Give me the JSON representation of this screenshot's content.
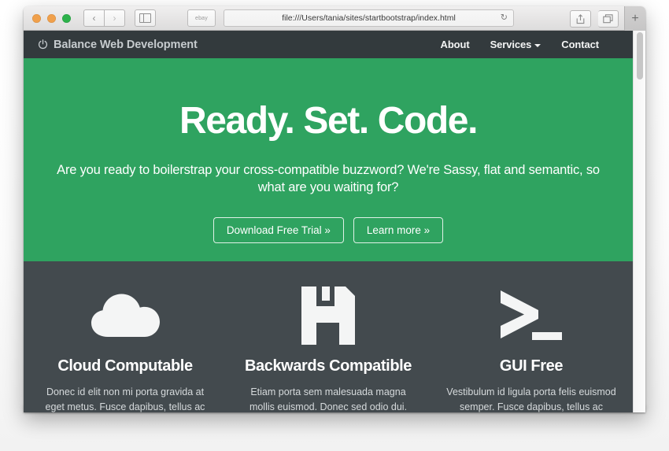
{
  "browser": {
    "traffic_lights": [
      "close",
      "minimize",
      "zoom"
    ],
    "back_label": "‹",
    "forward_label": "›",
    "sidebar_icon": "sidebar-icon",
    "bookmark_label": "ebay",
    "url": "file:///Users/tania/sites/startbootstrap/index.html",
    "reload_label": "↻",
    "share_icon": "share-icon",
    "tabs_icon": "tabs-icon",
    "new_tab_label": "+"
  },
  "site": {
    "nav": {
      "brand": "Balance Web Development",
      "brand_icon": "power-icon",
      "links": [
        {
          "label": "About",
          "has_caret": false
        },
        {
          "label": "Services",
          "has_caret": true
        },
        {
          "label": "Contact",
          "has_caret": false
        }
      ]
    },
    "hero": {
      "heading": "Ready. Set. Code.",
      "lead": "Are you ready to boilerstrap your cross-compatible buzzword? We're Sassy, flat and semantic, so what are you waiting for?",
      "primary_button": "Download Free Trial »",
      "secondary_button": "Learn more »"
    },
    "features": [
      {
        "icon": "cloud-icon",
        "title": "Cloud Computable",
        "body": "Donec id elit non mi porta gravida at eget metus. Fusce dapibus, tellus ac cursus commodo, tortor mauris condimentum"
      },
      {
        "icon": "floppy-disk-icon",
        "title": "Backwards Compatible",
        "body": "Etiam porta sem malesuada magna mollis euismod. Donec sed odio dui. Lorem ipsum dolor."
      },
      {
        "icon": "terminal-icon",
        "title": "GUI Free",
        "body": "Vestibulum id ligula porta felis euismod semper. Fusce dapibus, tellus ac cursus commodo, tortor mauris condimentum"
      }
    ],
    "colors": {
      "accent_green": "#2fa360",
      "dark_slate": "#434a4e",
      "navbar_dark": "#333a3d"
    }
  }
}
